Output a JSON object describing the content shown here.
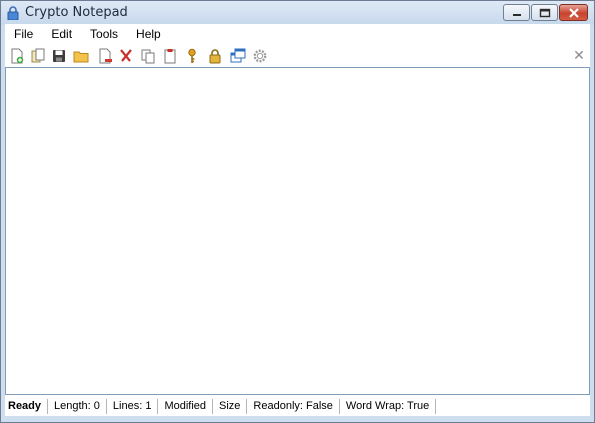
{
  "window": {
    "title": "Crypto Notepad",
    "icon": "padlock-icon"
  },
  "menu": [
    {
      "label": "File"
    },
    {
      "label": "Edit"
    },
    {
      "label": "Tools"
    },
    {
      "label": "Help"
    }
  ],
  "toolbar": {
    "buttons": [
      {
        "name": "new-file-icon"
      },
      {
        "name": "open-recent-icon"
      },
      {
        "name": "save-icon"
      },
      {
        "name": "open-folder-icon"
      },
      {
        "name": "delete-file-icon"
      },
      {
        "name": "cut-icon"
      },
      {
        "name": "copy-icon"
      },
      {
        "name": "paste-icon"
      },
      {
        "name": "change-key-icon"
      },
      {
        "name": "lock-icon"
      },
      {
        "name": "always-on-top-icon"
      },
      {
        "name": "settings-icon"
      }
    ],
    "close_icon": "close-icon"
  },
  "editor": {
    "content": ""
  },
  "statusbar": {
    "segments": [
      "Ready",
      "Length: 0",
      "Lines: 1",
      "Modified",
      "Size",
      "Readonly: False",
      "Word Wrap: True"
    ]
  },
  "colors": {
    "frame": "#cfdeef",
    "close_button": "#c7422f",
    "editor_border": "#7f9db9"
  }
}
